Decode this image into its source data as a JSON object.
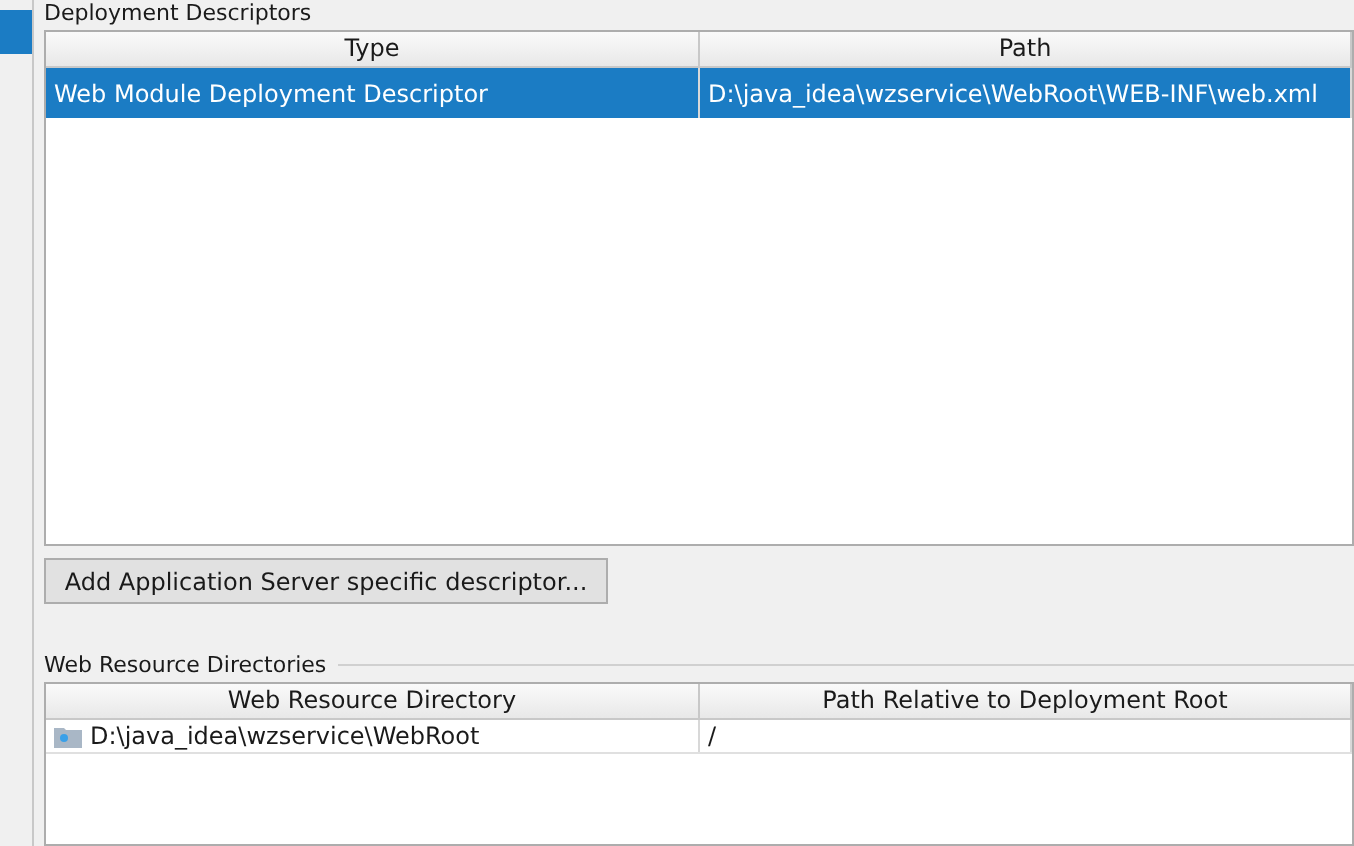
{
  "descriptors": {
    "title": "Deployment Descriptors",
    "columns": [
      "Type",
      "Path"
    ],
    "rows": [
      {
        "type": "Web Module Deployment Descriptor",
        "path": "D:\\java_idea\\wzservice\\WebRoot\\WEB-INF\\web.xml",
        "selected": true
      }
    ]
  },
  "add_button": "Add Application Server specific descriptor...",
  "resources": {
    "title": "Web Resource Directories",
    "columns": [
      "Web Resource Directory",
      "Path Relative to Deployment Root"
    ],
    "rows": [
      {
        "directory": "D:\\java_idea\\wzservice\\WebRoot",
        "relative_path": "/",
        "selected": false
      }
    ]
  }
}
